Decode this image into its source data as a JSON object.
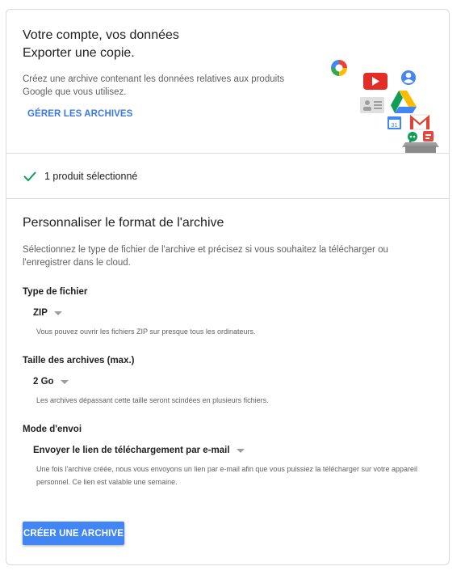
{
  "header": {
    "title_line1": "Votre compte, vos données",
    "title_line2": "Exporter une copie.",
    "description": "Créez une archive contenant les données relatives aux produits Google que vous utilisez.",
    "manage_link": "GÉRER LES ARCHIVES",
    "icons": [
      "picasa-icon",
      "youtube-icon",
      "profile-icon",
      "contacts-icon",
      "drive-icon",
      "calendar-icon",
      "gmail-icon",
      "hangouts-icon",
      "blogger-icon",
      "archive-box-icon"
    ],
    "calendar_day": "31"
  },
  "selection": {
    "text": "1 produit sélectionné",
    "icon": "check-icon"
  },
  "format": {
    "title": "Personnaliser le format de l'archive",
    "description": "Sélectionnez le type de fichier de l'archive et précisez si vous souhaitez la télécharger ou l'enregistrer dans le cloud.",
    "file_type": {
      "label": "Type de fichier",
      "value": "ZIP",
      "hint": "Vous pouvez ouvrir les fichiers ZIP sur presque tous les ordinateurs."
    },
    "archive_size": {
      "label": "Taille des archives (max.)",
      "value": "2 Go",
      "hint": "Les archives dépassant cette taille seront scindées en plusieurs fichiers."
    },
    "delivery": {
      "label": "Mode d'envoi",
      "value": "Envoyer le lien de téléchargement par e-mail",
      "hint": "Une fois l'archive créée, nous vous envoyons un lien par e-mail afin que vous puissiez la télécharger sur votre appareil personnel. Ce lien est valable une semaine."
    },
    "create_button": "CRÉER UNE ARCHIVE"
  },
  "colors": {
    "accent": "#4285f4",
    "link": "#3b78e7",
    "check": "#0f9d58"
  }
}
